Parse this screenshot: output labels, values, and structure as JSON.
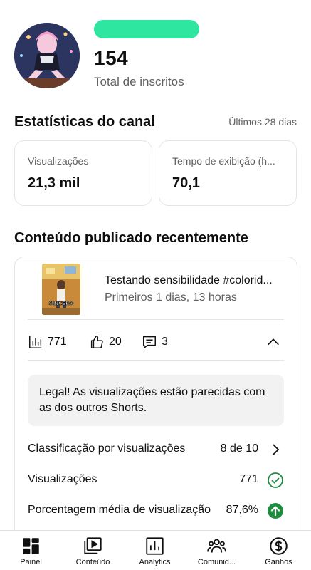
{
  "channel": {
    "subscriber_count": "154",
    "subscriber_label": "Total de inscritos"
  },
  "stats": {
    "title": "Estatísticas do canal",
    "period": "Últimos 28 dias",
    "cards": [
      {
        "label": "Visualizações",
        "value": "21,3 mil"
      },
      {
        "label": "Tempo de exibição (h...",
        "value": "70,1"
      }
    ]
  },
  "recent": {
    "title": "Conteúdo publicado recentemente",
    "video": {
      "title": "Testando sensibilidade #colorid...",
      "subtitle": "Primeiros 1 dias, 13 horas",
      "thumbnail_text": "SINCERO",
      "views": "771",
      "likes": "20",
      "comments": "3"
    },
    "note": "Legal! As visualizações estão parecidas com as dos outros Shorts.",
    "rows": [
      {
        "label": "Classificação por visualizações",
        "value": "8 de 10",
        "icon": "chevron-right-icon"
      },
      {
        "label": "Visualizações",
        "value": "771",
        "icon": "check-circle-icon"
      },
      {
        "label": "Porcentagem média de visualização",
        "value": "87,6%",
        "icon": "arrow-up-circle-icon"
      }
    ]
  },
  "colors": {
    "redaction": "#2ee6a0",
    "success_green": "#1e8e3e",
    "text_primary": "#0f0f0f",
    "text_secondary": "#606060"
  },
  "nav": [
    {
      "label": "Painel",
      "icon": "dashboard-icon"
    },
    {
      "label": "Conteúdo",
      "icon": "content-icon"
    },
    {
      "label": "Analytics",
      "icon": "analytics-icon"
    },
    {
      "label": "Comunid...",
      "icon": "community-icon"
    },
    {
      "label": "Ganhos",
      "icon": "earn-icon"
    }
  ]
}
